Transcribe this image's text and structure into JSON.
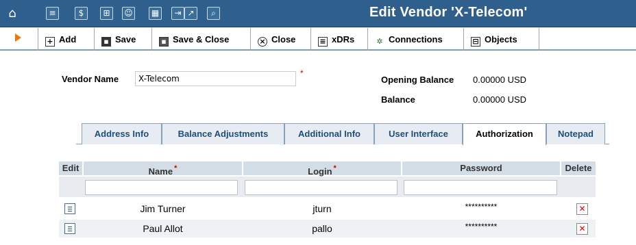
{
  "window": {
    "title": "Edit Vendor 'X-Telecom'"
  },
  "topbar": {
    "icons": [
      "home-icon",
      "list-icon",
      "dollar-icon",
      "grid-icon",
      "person-icon",
      "module-icon",
      "export-icon",
      "chart-icon",
      "search-icon"
    ],
    "glyphs": {
      "home": "⌂",
      "list": "≡",
      "dollar": "$",
      "grid": "⊞",
      "person": "☺",
      "module": "▦",
      "export": "⇥",
      "chart": "↗",
      "search": "⌕"
    }
  },
  "toolbar": {
    "add_label": "Add",
    "save_label": "Save",
    "save_close_label": "Save & Close",
    "close_label": "Close",
    "xdrs_label": "xDRs",
    "connections_label": "Connections",
    "objects_label": "Objects"
  },
  "form": {
    "vendor_name_label": "Vendor Name",
    "vendor_name_value": "X-Telecom",
    "required_mark": "*",
    "opening_balance_label": "Opening Balance",
    "opening_balance_value": "0.00000 USD",
    "balance_label": "Balance",
    "balance_value": "0.00000 USD"
  },
  "tabs": [
    {
      "label": "Address Info",
      "active": false
    },
    {
      "label": "Balance Adjustments",
      "active": false
    },
    {
      "label": "Additional Info",
      "active": false
    },
    {
      "label": "User Interface",
      "active": false
    },
    {
      "label": "Authorization",
      "active": true
    },
    {
      "label": "Notepad",
      "active": false
    }
  ],
  "table": {
    "columns": {
      "edit": "Edit",
      "name": "Name",
      "login": "Login",
      "password": "Password",
      "delete": "Delete"
    },
    "rows": [
      {
        "name": "Jim Turner",
        "login": "jturn",
        "password": "**********"
      },
      {
        "name": "Paul Allot",
        "login": "pallo",
        "password": "**********"
      }
    ]
  },
  "colors": {
    "titlebar": "#2f5f8c",
    "accent_arrow": "#e87a00",
    "tab_text": "#1f4d7a",
    "delete_x": "#e00000"
  }
}
